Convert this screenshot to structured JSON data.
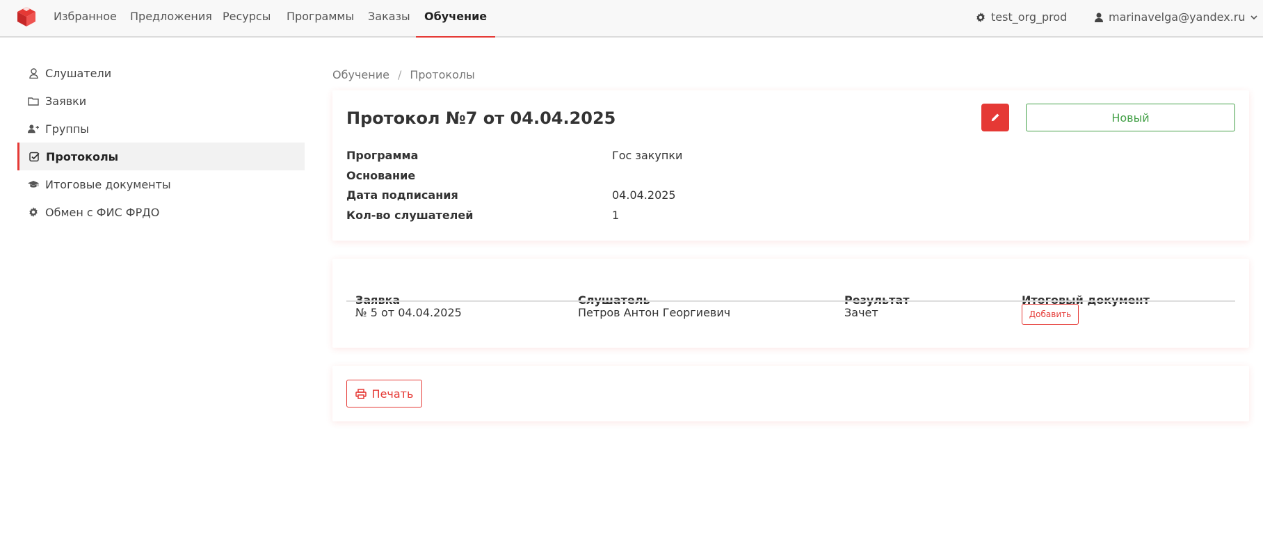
{
  "nav": {
    "items": [
      {
        "label": "Избранное"
      },
      {
        "label": "Предложения"
      },
      {
        "label": "Ресурсы"
      },
      {
        "label": "Программы"
      },
      {
        "label": "Заказы"
      },
      {
        "label": "Обучение"
      }
    ],
    "active_index": 5,
    "org": "test_org_prod",
    "user": "marinavelga@yandex.ru"
  },
  "sidebar": {
    "items": [
      {
        "label": "Слушатели",
        "icon": "user-icon"
      },
      {
        "label": "Заявки",
        "icon": "folder-icon"
      },
      {
        "label": "Группы",
        "icon": "user-plus-icon"
      },
      {
        "label": "Протоколы",
        "icon": "check-square-icon"
      },
      {
        "label": "Итоговые документы",
        "icon": "graduation-cap-icon"
      },
      {
        "label": "Обмен с ФИС ФРДО",
        "icon": "gear-icon"
      }
    ],
    "active_index": 3
  },
  "breadcrumb": {
    "items": [
      "Обучение",
      "Протоколы"
    ],
    "separator": "/"
  },
  "protocol": {
    "title": "Протокол №7 от 04.04.2025",
    "status": "Новый",
    "fields": [
      {
        "label": "Программа",
        "value": "Гос закупки"
      },
      {
        "label": "Основание",
        "value": ""
      },
      {
        "label": "Дата подписания",
        "value": "04.04.2025"
      },
      {
        "label": "Кол-во слушателей",
        "value": "1"
      }
    ]
  },
  "table": {
    "headers": [
      "Заявка",
      "Слушатель",
      "Результат",
      "Итоговый документ"
    ],
    "rows": [
      {
        "application": "№ 5 от 04.04.2025",
        "listener": "Петров Антон Георгиевич",
        "result": "Зачет",
        "action": "Добавить"
      }
    ]
  },
  "print": {
    "label": "Печать"
  },
  "colors": {
    "accent": "#e53935",
    "success": "#43a047"
  }
}
